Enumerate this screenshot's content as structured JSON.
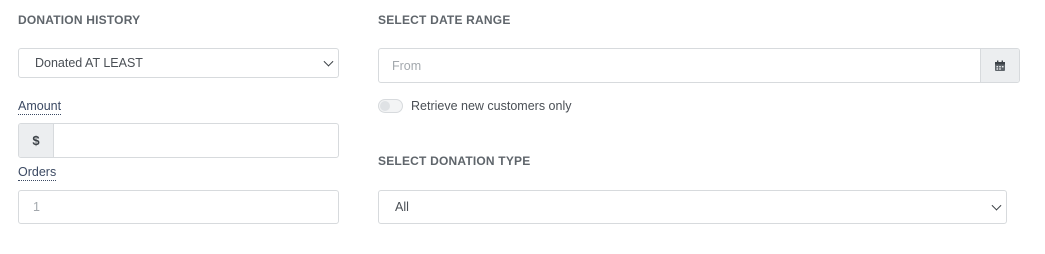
{
  "donation_history": {
    "title": "DONATION HISTORY",
    "select_value": "Donated AT LEAST",
    "amount": {
      "label": "Amount",
      "prefix": "$",
      "value": ""
    },
    "orders": {
      "label": "Orders",
      "placeholder": "1"
    }
  },
  "date_range": {
    "title": "SELECT DATE RANGE",
    "from_placeholder": "From",
    "calendar_icon": "calendar-icon",
    "toggle_label": "Retrieve new customers only",
    "toggle_on": false
  },
  "donation_type": {
    "title": "SELECT DONATION TYPE",
    "select_value": "All"
  }
}
